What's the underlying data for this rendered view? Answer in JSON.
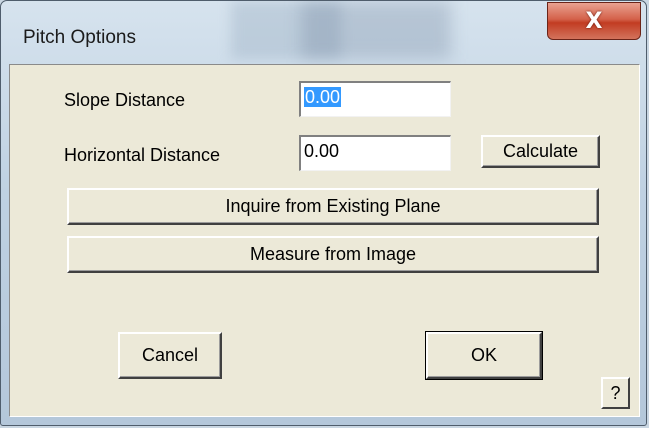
{
  "window": {
    "title": "Pitch Options",
    "close_glyph": "X"
  },
  "form": {
    "slope_label": "Slope Distance",
    "slope_value": "0.00",
    "horizontal_label": "Horizontal Distance",
    "horizontal_value": "0.00",
    "calculate_label": "Calculate",
    "inquire_label": "Inquire from Existing Plane",
    "measure_label": "Measure from Image"
  },
  "footer": {
    "cancel_label": "Cancel",
    "ok_label": "OK",
    "help_label": "?"
  },
  "colors": {
    "dialog_face": "#ece9d8",
    "selection": "#3399ff",
    "close_button": "#c23c22"
  },
  "icons": [
    "close-icon",
    "help-icon"
  ]
}
